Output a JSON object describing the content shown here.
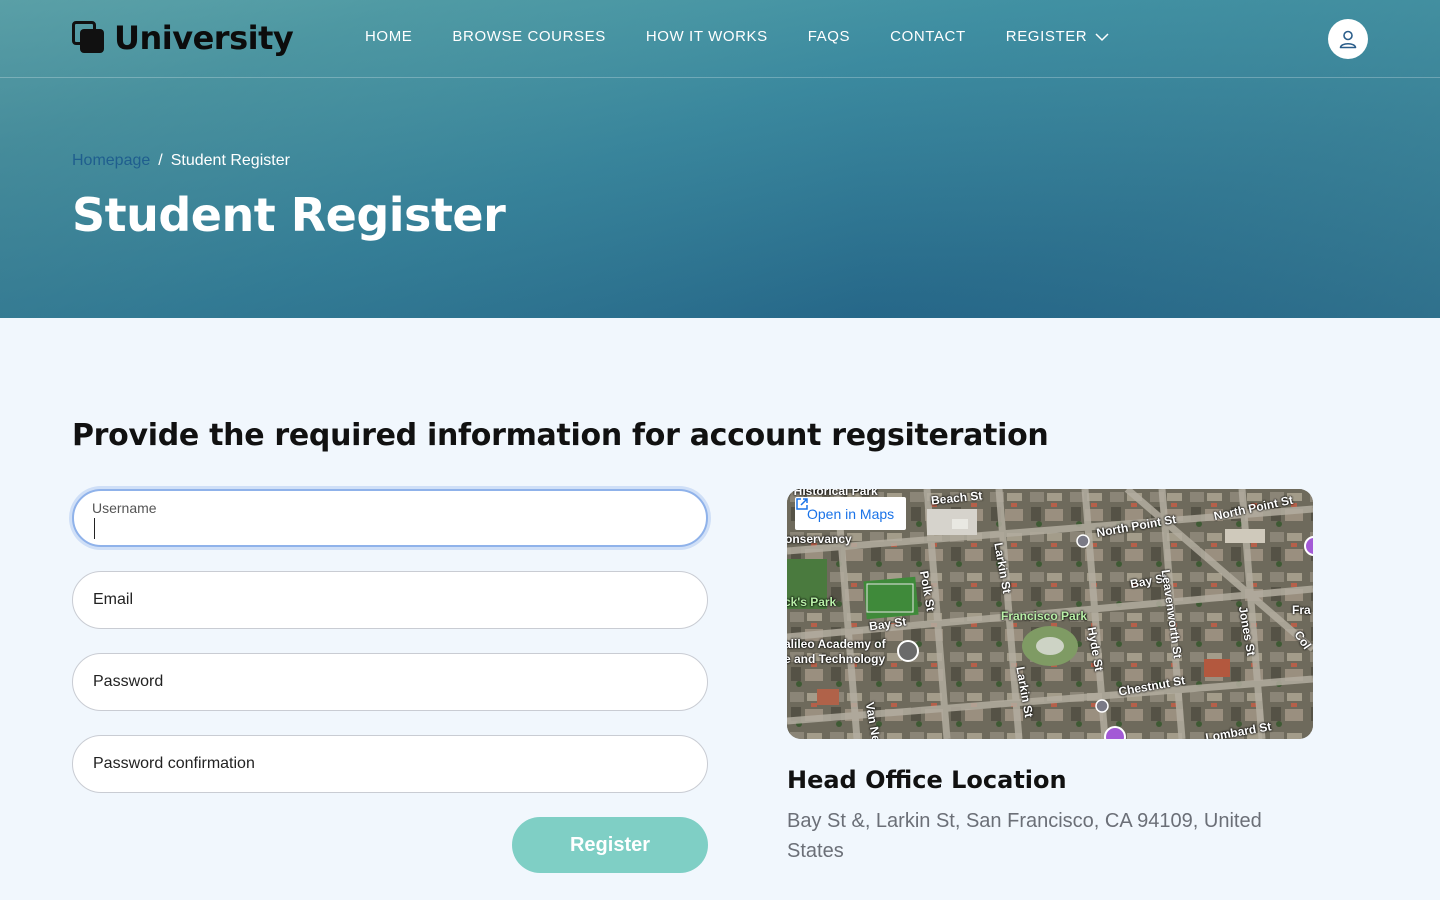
{
  "brand": {
    "name": "University"
  },
  "nav": {
    "items": [
      "HOME",
      "BROWSE COURSES",
      "HOW IT WORKS",
      "FAQS",
      "CONTACT"
    ],
    "register_label": "REGISTER"
  },
  "breadcrumb": {
    "home": "Homepage",
    "separator": "/",
    "current": "Student Register"
  },
  "page": {
    "title": "Student Register"
  },
  "form": {
    "heading": "Provide the required information for account regsiteration",
    "username_label": "Username",
    "username_value": "",
    "email_placeholder": "Email",
    "password_placeholder": "Password",
    "password_confirmation_placeholder": "Password confirmation",
    "submit_label": "Register"
  },
  "map": {
    "open_label": "Open in Maps",
    "labels": {
      "beach_st": "Beach St",
      "north_point_1": "North Point St",
      "north_point_2": "North Point St",
      "conservancy": "onservancy",
      "historical_park": "n Historical Park",
      "polk_st": "Polk St",
      "larkin_st_1": "Larkin St",
      "bay_st_1": "Bay St",
      "bay_st_2": "Bay St",
      "leavenworth": "Leavenworth St",
      "jones_st": "Jones St",
      "francisco_park": "Francisco Park",
      "hyde_st": "Hyde St",
      "aquatic_park": "ck's Park",
      "galileo_1": "alileo Academy of",
      "galileo_2": "e and Technology",
      "larkin_st_2": "Larkin St",
      "chestnut_st": "Chestnut St",
      "lombard_st": "Lombard St",
      "van_ness": "Van Ne",
      "fra": "Fra",
      "col": "Col"
    }
  },
  "location": {
    "title": "Head Office Location",
    "address": "Bay St &, Larkin St, San Francisco, CA 94109, United States"
  },
  "colors": {
    "accent": "#7fcfc5",
    "focus": "#8fb2ea",
    "link": "#1a73e8"
  }
}
